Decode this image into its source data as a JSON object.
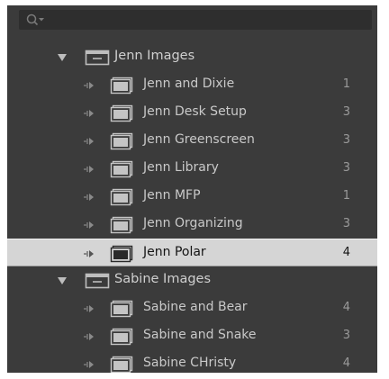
{
  "search": {
    "placeholder": ""
  },
  "tree": [
    {
      "type": "set",
      "label": "Jenn Images",
      "expanded": true
    },
    {
      "type": "collection",
      "label": "Jenn and Dixie",
      "count": "1"
    },
    {
      "type": "collection",
      "label": "Jenn Desk Setup",
      "count": "3"
    },
    {
      "type": "collection",
      "label": "Jenn Greenscreen",
      "count": "3"
    },
    {
      "type": "collection",
      "label": "Jenn Library",
      "count": "3"
    },
    {
      "type": "collection",
      "label": "Jenn MFP",
      "count": "1"
    },
    {
      "type": "collection",
      "label": "Jenn Organizing",
      "count": "3"
    },
    {
      "type": "collection",
      "label": "Jenn Polar",
      "count": "4",
      "selected": true
    },
    {
      "type": "set",
      "label": "Sabine Images",
      "expanded": true
    },
    {
      "type": "collection",
      "label": "Sabine and Bear",
      "count": "4"
    },
    {
      "type": "collection",
      "label": "Sabine and Snake",
      "count": "3"
    },
    {
      "type": "collection",
      "label": "Sabine CHristy",
      "count": "4"
    }
  ],
  "colors": {
    "panel": "#3b3b3b",
    "selected_row": "#d5d5d5",
    "label": "#c9c9c9",
    "count": "#9a9a9a"
  },
  "icons": {
    "search": "search-icon",
    "set_disclosure": "triangle-down-icon",
    "collection_disclosure": "arrow-right-icon",
    "set": "collection-set-icon",
    "collection": "collection-icon"
  }
}
